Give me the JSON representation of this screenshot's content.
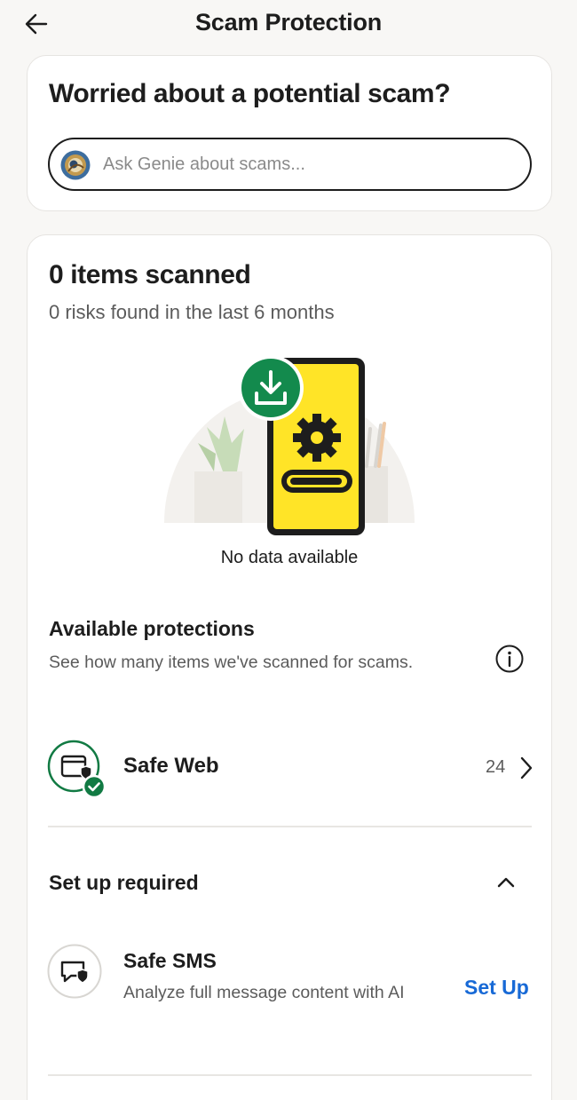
{
  "header": {
    "title": "Scam Protection",
    "back_icon": "arrow-left-icon"
  },
  "genie_card": {
    "title": "Worried about a potential scam?",
    "input": {
      "placeholder": "Ask Genie about scams...",
      "value": ""
    },
    "icon": "genie-avatar-icon"
  },
  "scan_card": {
    "title": "0 items scanned",
    "subtitle": "0 risks found in the last 6 months",
    "illustration": "phone-download-gear-illustration",
    "empty_text": "No data available"
  },
  "protections": {
    "title": "Available protections",
    "description": "See how many items we've scanned for scams.",
    "info_icon": "info-icon",
    "items": [
      {
        "label": "Safe Web",
        "count": "24",
        "icon": "browser-shield-icon",
        "status": "active"
      }
    ]
  },
  "setup": {
    "title": "Set up required",
    "toggle_icon": "chevron-up-icon",
    "items": [
      {
        "label": "Safe SMS",
        "description": "Analyze full message content with AI",
        "action": "Set Up",
        "icon": "message-shield-icon"
      }
    ]
  },
  "colors": {
    "accent_green": "#117a43",
    "link_blue": "#1769d6",
    "phone_yellow": "#ffe427",
    "background": "#f8f7f5"
  }
}
